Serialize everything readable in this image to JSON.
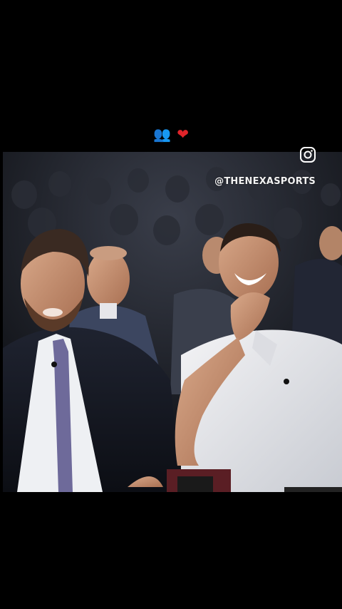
{
  "caption": {
    "emojis": [
      "users-emoji",
      "heart-emoji"
    ],
    "users_glyph": "👥",
    "heart_glyph": "❤"
  },
  "video": {
    "description_icon": "instagram-icon",
    "watermark": "@THENEXASPORTS"
  },
  "colors": {
    "background": "#000000",
    "heart": "#e0242a",
    "users": "#4a7fc4"
  }
}
